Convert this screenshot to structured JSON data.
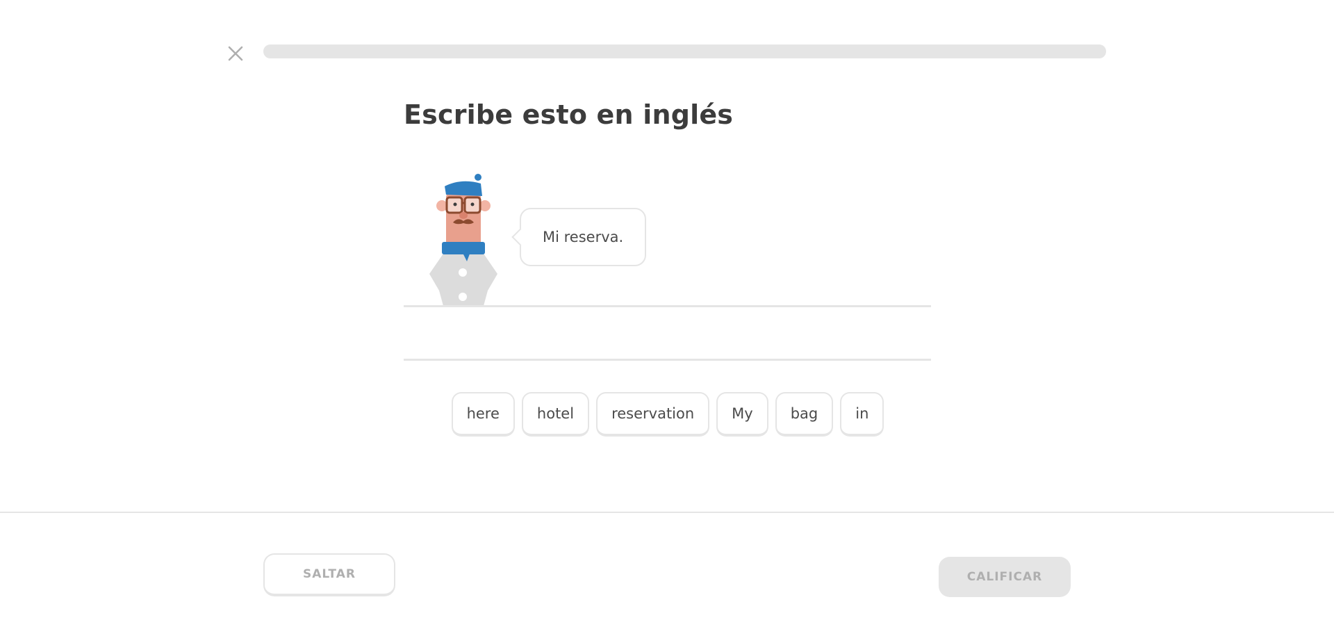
{
  "header": {
    "close_icon": "close-icon",
    "progress": 0
  },
  "challenge": {
    "title": "Escribe esto en inglés",
    "prompt": "Mi reserva."
  },
  "word_bank": {
    "words": [
      "here",
      "hotel",
      "reservation",
      "My",
      "bag",
      "in"
    ]
  },
  "footer": {
    "skip_label": "SALTAR",
    "check_label": "CALIFICAR"
  },
  "colors": {
    "progress_track": "#e5e5e5",
    "tile_border": "#e5e5e5",
    "text": "#3c3c3c",
    "disabled_text": "#afafaf",
    "character_beret": "#2f7fc1",
    "character_skin": "#e8a08d"
  }
}
